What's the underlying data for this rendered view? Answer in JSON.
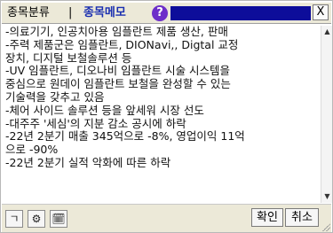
{
  "window": {
    "tab_category": "종목분류",
    "tab_separator": "|",
    "tab_memo": "종목메모",
    "help_label": "?",
    "close_label": "X"
  },
  "memo": {
    "lines": [
      "-의료기기, 인공치아용 임플란트 제품 생산, 판매",
      "-주력 제품군은 임플란트, DIONavi,, Digtal 교정",
      "장치, 디지털 보철솔루션 등",
      "-UV 임플란트, 디오나비 임플란트 시술 시스템을",
      "중심으로 원데이 임플란트 보철을 완성할 수 있는",
      "기술력을 갖추고 있음",
      "-체어 사이드 솔루션 등을 앞세워 시장 선도",
      "-대주주 '세심'의 지분 감소 공시에 하락",
      "-22년 2분기 매출 345억으로 -8%, 영업이익 11억",
      "으로 -90%",
      "-22년 2분기 실적 악화에 따른 하락"
    ]
  },
  "scrollbar": {
    "up_icon": "▲",
    "down_icon": "▼"
  },
  "toolbar": {
    "btn1_label": "ㄱ",
    "btn2_label": "⚙",
    "btn3_label": "🗓",
    "confirm_label": "확인",
    "cancel_label": "취소"
  },
  "colors": {
    "memo_tab": "#1a2fb0",
    "help_icon": "#6d2fc9",
    "title_strip": "#0d0d9a",
    "bar_bg": "#ece9d8"
  }
}
